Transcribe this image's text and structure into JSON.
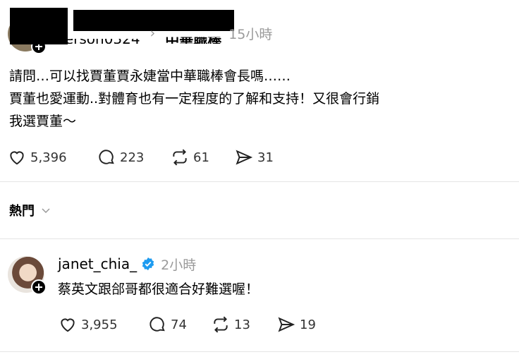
{
  "post": {
    "username_partial": "verson0324",
    "breadcrumb_sep": "›",
    "topic": "中華職棒",
    "time": "15小時",
    "lines": [
      "請問…可以找賈董賈永婕當中華職棒會長嗎……",
      "賈董也愛運動..對體育也有一定程度的了解和支持！又很會行銷",
      "我選賈董～"
    ],
    "likes": "5,396",
    "comments": "223",
    "reposts": "61",
    "shares": "31"
  },
  "sort": {
    "label": "熱門",
    "icon": "chevron-down-icon"
  },
  "reply": {
    "username": "janet_chia_",
    "verified_icon": "verified-badge-icon",
    "time": "2小時",
    "text": "蔡英文跟郃哥都很適合好難選喔！",
    "likes": "3,955",
    "comments": "74",
    "reposts": "13",
    "shares": "19"
  },
  "colors": {
    "verified": "#1d9bf0",
    "muted": "#9a9a9a",
    "divider": "#e5e5e5"
  }
}
